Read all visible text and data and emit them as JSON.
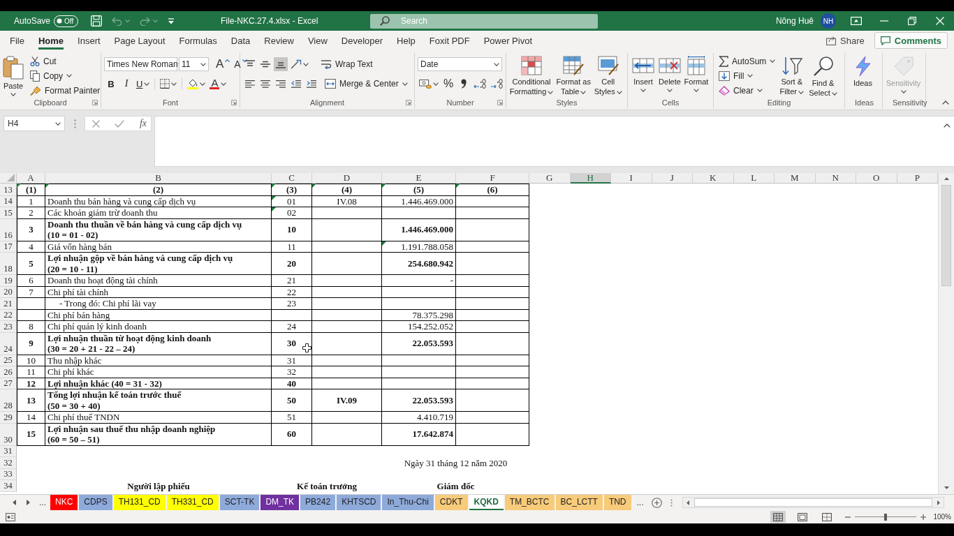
{
  "title_bar": {
    "autosave_label": "AutoSave",
    "autosave_on": false,
    "autosave_state": "Off",
    "undo_disabled": true,
    "redo_disabled": true,
    "document_title": "File-NKC.27.4.xlsx - Excel",
    "search_placeholder": "Search",
    "user_name": "Nông Huê",
    "user_initials": "NH"
  },
  "ribbon_tabs": [
    {
      "label": "File",
      "selected": false
    },
    {
      "label": "Home",
      "selected": true
    },
    {
      "label": "Insert",
      "selected": false
    },
    {
      "label": "Page Layout",
      "selected": false
    },
    {
      "label": "Formulas",
      "selected": false
    },
    {
      "label": "Data",
      "selected": false
    },
    {
      "label": "Review",
      "selected": false
    },
    {
      "label": "View",
      "selected": false
    },
    {
      "label": "Developer",
      "selected": false
    },
    {
      "label": "Help",
      "selected": false
    },
    {
      "label": "Foxit PDF",
      "selected": false
    },
    {
      "label": "Power Pivot",
      "selected": false
    }
  ],
  "ribbon_actions": {
    "share": "Share",
    "comments": "Comments"
  },
  "ribbon": {
    "clipboard": {
      "name": "Clipboard",
      "paste": "Paste",
      "cut": "Cut",
      "copy": "Copy",
      "format_painter": "Format Painter"
    },
    "font": {
      "name": "Font",
      "font_name": "Times New Roman",
      "font_size": "11",
      "grow": "A",
      "shrink": "A",
      "bold": "B",
      "italic": "I",
      "underline": "U",
      "font_color": "A"
    },
    "alignment": {
      "name": "Alignment",
      "vertical": [
        {
          "selected": false
        },
        {
          "selected": false
        },
        {
          "selected": true
        }
      ],
      "wrap_text": "Wrap Text",
      "merge_center": "Merge & Center"
    },
    "number": {
      "name": "Number",
      "format": "Date",
      "percent": "%"
    },
    "styles": {
      "name": "Styles",
      "buttons": [
        "Conditional Formatting",
        "Format as Table",
        "Cell Styles"
      ]
    },
    "cells": {
      "name": "Cells",
      "buttons": [
        "Insert",
        "Delete",
        "Format"
      ]
    },
    "editing": {
      "name": "Editing",
      "autosum": "AutoSum",
      "fill": "Fill",
      "clear": "Clear",
      "sort_filter": "Sort & Filter",
      "find_select": "Find & Select"
    },
    "ideas": {
      "name": "Ideas",
      "button": "Ideas",
      "disabled": false
    },
    "sensitivity": {
      "name": "Sensitivity",
      "button": "Sensitivity",
      "disabled": true
    }
  },
  "formula_bar": {
    "name_box": "H4",
    "function_label": "fx"
  },
  "sheet": {
    "columns": [
      {
        "label": "A",
        "selected": false
      },
      {
        "label": "B",
        "selected": false
      },
      {
        "label": "C",
        "selected": false
      },
      {
        "label": "D",
        "selected": false
      },
      {
        "label": "E",
        "selected": false
      },
      {
        "label": "F",
        "selected": false
      },
      {
        "label": "G",
        "selected": false
      },
      {
        "label": "H",
        "selected": true
      },
      {
        "label": "I",
        "selected": false
      },
      {
        "label": "J",
        "selected": false
      },
      {
        "label": "K",
        "selected": false
      },
      {
        "label": "L",
        "selected": false
      },
      {
        "label": "M",
        "selected": false
      },
      {
        "label": "N",
        "selected": false
      },
      {
        "label": "O",
        "selected": false
      },
      {
        "label": "P",
        "selected": false
      }
    ],
    "rows": [
      {
        "row": "13",
        "kind": "header",
        "bold": true,
        "indented": false,
        "cells": [
          {
            "text": "(1)",
            "marked": true
          },
          {
            "text": "(2)",
            "marked": true
          },
          {
            "text": "(3)",
            "marked": true
          },
          {
            "text": "(4)",
            "marked": true
          },
          {
            "text": "(5)",
            "marked": true
          },
          {
            "text": "(6)",
            "marked": true
          }
        ]
      },
      {
        "row": "14",
        "kind": "table",
        "bold": false,
        "indented": false,
        "cells": [
          {
            "text": "1",
            "marked": false
          },
          {
            "text": "Doanh thu bán hàng và cung cấp dịch vụ",
            "marked": false
          },
          {
            "text": "01",
            "marked": true
          },
          {
            "text": "IV.08",
            "marked": false
          },
          {
            "text": "1.446.469.000",
            "marked": false
          },
          {
            "marked": false
          }
        ]
      },
      {
        "row": "15",
        "kind": "table",
        "bold": false,
        "indented": false,
        "cells": [
          {
            "text": "2",
            "marked": false
          },
          {
            "text": "Các khoản giảm trừ doanh thu",
            "marked": false
          },
          {
            "text": "02",
            "marked": true
          },
          {
            "marked": false
          },
          {
            "marked": false
          },
          {
            "marked": false
          }
        ]
      },
      {
        "row": "16",
        "kind": "table",
        "bold": true,
        "indented": false,
        "cells": [
          {
            "text": "3",
            "marked": false
          },
          {
            "text": "Doanh thu thuần về bán hàng và cung cấp dịch vụ\n(10 = 01 - 02)",
            "marked": false
          },
          {
            "text": "10",
            "marked": false
          },
          {
            "marked": false
          },
          {
            "text": "1.446.469.000",
            "marked": false
          },
          {
            "marked": false
          }
        ]
      },
      {
        "row": "17",
        "kind": "table",
        "bold": false,
        "indented": false,
        "cells": [
          {
            "text": "4",
            "marked": false
          },
          {
            "text": "Giá vốn hàng bán",
            "marked": false
          },
          {
            "text": "11",
            "marked": false
          },
          {
            "marked": false
          },
          {
            "text": "1.191.788.058",
            "marked": true
          },
          {
            "marked": false
          }
        ]
      },
      {
        "row": "18",
        "kind": "table",
        "bold": true,
        "indented": false,
        "cells": [
          {
            "text": "5",
            "marked": false
          },
          {
            "text": "Lợi nhuận gộp về bán hàng và cung cấp dịch vụ\n(20 = 10 - 11)",
            "marked": false
          },
          {
            "text": "20",
            "marked": false
          },
          {
            "marked": false
          },
          {
            "text": "254.680.942",
            "marked": false
          },
          {
            "marked": false
          }
        ]
      },
      {
        "row": "19",
        "kind": "table",
        "bold": false,
        "indented": false,
        "cells": [
          {
            "text": "6",
            "marked": false
          },
          {
            "text": "Doanh thu hoạt động tài chính",
            "marked": false
          },
          {
            "text": "21",
            "marked": false
          },
          {
            "marked": false
          },
          {
            "text": "-",
            "marked": false
          },
          {
            "marked": false
          }
        ]
      },
      {
        "row": "20",
        "kind": "table",
        "bold": false,
        "indented": false,
        "cells": [
          {
            "text": "7",
            "marked": false
          },
          {
            "text": "Chi phí tài chính",
            "marked": false
          },
          {
            "text": "22",
            "marked": false
          },
          {
            "marked": false
          },
          {
            "marked": false
          },
          {
            "marked": false
          }
        ]
      },
      {
        "row": "21",
        "kind": "table",
        "bold": false,
        "indented": true,
        "cells": [
          {
            "marked": false
          },
          {
            "text": "- Trong đó: Chi phí lãi vay",
            "marked": false
          },
          {
            "text": "23",
            "marked": false
          },
          {
            "marked": false
          },
          {
            "marked": false
          },
          {
            "marked": false
          }
        ]
      },
      {
        "row": "22",
        "kind": "table",
        "bold": false,
        "indented": false,
        "cells": [
          {
            "marked": false
          },
          {
            "text": "Chi phí bán hàng",
            "marked": false
          },
          {
            "marked": false
          },
          {
            "marked": false
          },
          {
            "text": "78.375.298",
            "marked": false
          },
          {
            "marked": false
          }
        ]
      },
      {
        "row": "23",
        "kind": "table",
        "bold": false,
        "indented": false,
        "cells": [
          {
            "text": "8",
            "marked": false
          },
          {
            "text": "Chi phí quản lý kinh doanh",
            "marked": false
          },
          {
            "text": "24",
            "marked": false
          },
          {
            "marked": false
          },
          {
            "text": "154.252.052",
            "marked": false
          },
          {
            "marked": false
          }
        ]
      },
      {
        "row": "24",
        "kind": "table",
        "bold": true,
        "indented": false,
        "cells": [
          {
            "text": "9",
            "marked": false
          },
          {
            "text": "Lợi nhuận thuần từ hoạt động kinh doanh\n(30 = 20 + 21 - 22 – 24)",
            "marked": false
          },
          {
            "text": "30",
            "marked": false
          },
          {
            "marked": false
          },
          {
            "text": "22.053.593",
            "marked": false
          },
          {
            "marked": false
          }
        ]
      },
      {
        "row": "25",
        "kind": "table",
        "bold": false,
        "indented": false,
        "cells": [
          {
            "text": "10",
            "marked": false
          },
          {
            "text": "Thu nhập khác",
            "marked": false
          },
          {
            "text": "31",
            "marked": false
          },
          {
            "marked": false
          },
          {
            "marked": false
          },
          {
            "marked": false
          }
        ]
      },
      {
        "row": "26",
        "kind": "table",
        "bold": false,
        "indented": false,
        "cells": [
          {
            "text": "11",
            "marked": false
          },
          {
            "text": "Chi phí khác",
            "marked": false
          },
          {
            "text": "32",
            "marked": false
          },
          {
            "marked": false
          },
          {
            "marked": false
          },
          {
            "marked": false
          }
        ]
      },
      {
        "row": "27",
        "kind": "table",
        "bold": true,
        "indented": false,
        "cells": [
          {
            "text": "12",
            "marked": false
          },
          {
            "text": "Lợi nhuận khác (40 = 31 - 32)",
            "marked": false
          },
          {
            "text": "40",
            "marked": false
          },
          {
            "marked": false
          },
          {
            "marked": false
          },
          {
            "marked": false
          }
        ]
      },
      {
        "row": "28",
        "kind": "table",
        "bold": true,
        "indented": false,
        "cells": [
          {
            "text": "13",
            "marked": false
          },
          {
            "text": "Tổng lợi nhuận kế toán trước thuế\n(50 = 30 + 40)",
            "marked": false
          },
          {
            "text": "50",
            "marked": false
          },
          {
            "text": "IV.09",
            "marked": false
          },
          {
            "text": "22.053.593",
            "marked": false
          },
          {
            "marked": false
          }
        ]
      },
      {
        "row": "29",
        "kind": "table",
        "bold": false,
        "indented": false,
        "cells": [
          {
            "text": "14",
            "marked": false
          },
          {
            "text": "Chi phí thuế TNDN",
            "marked": false
          },
          {
            "text": "51",
            "marked": false
          },
          {
            "marked": false
          },
          {
            "text": "4.410.719",
            "marked": false
          },
          {
            "marked": false
          }
        ]
      },
      {
        "row": "30",
        "kind": "table",
        "bold": true,
        "indented": false,
        "cells": [
          {
            "text": "15",
            "marked": false
          },
          {
            "text": "Lợi nhuận sau thuế thu nhập doanh nghiệp\n(60 = 50 – 51)",
            "marked": false
          },
          {
            "text": "60",
            "marked": false
          },
          {
            "marked": false
          },
          {
            "text": "17.642.874",
            "marked": false
          },
          {
            "marked": false
          }
        ]
      },
      {
        "row": "31",
        "kind": "note"
      },
      {
        "row": "32",
        "kind": "note",
        "bold": false,
        "e_f": "Ngày 31 tháng 12 năm 2020"
      },
      {
        "row": "33",
        "kind": "note"
      },
      {
        "row": "34",
        "kind": "note",
        "bold": true,
        "b": "Người lập phiếu",
        "c_d": "Kế toán trưởng",
        "e_f": "Giám đốc"
      }
    ]
  },
  "sheet_tab_bar": {
    "more_left": "...",
    "tabs": [
      {
        "label": "NKC",
        "color": "#ff0000",
        "selected": false
      },
      {
        "label": "CDPS",
        "color": "#8eaadb",
        "selected": false
      },
      {
        "label": "TH131_CD",
        "color": "#ffff00",
        "selected": false
      },
      {
        "label": "TH331_CD",
        "color": "#ffff00",
        "selected": false
      },
      {
        "label": "SCT-TK",
        "color": "#8eaadb",
        "selected": false
      },
      {
        "label": "DM_TK",
        "color": "#7030a0",
        "selected": false
      },
      {
        "label": "PB242",
        "color": "#8eaadb",
        "selected": false
      },
      {
        "label": "KHTSCD",
        "color": "#8eaadb",
        "selected": false
      },
      {
        "label": "In_Thu-Chi",
        "color": "#8eaadb",
        "selected": false
      },
      {
        "label": "CDKT",
        "color": "#f8cb7a",
        "selected": false
      },
      {
        "label": "KQKD",
        "selected": true
      },
      {
        "label": "TM_BCTC",
        "color": "#f8cb7a",
        "selected": false
      },
      {
        "label": "BC_LCTT",
        "color": "#f8cb7a",
        "selected": false
      },
      {
        "label": "TND",
        "color": "#f8cb7a",
        "selected": false
      }
    ],
    "more_right": "..."
  },
  "status_bar": {
    "views": [
      {
        "selected": true
      },
      {
        "selected": false
      },
      {
        "selected": false
      }
    ],
    "zoom_slider": {
      "level": 0.5
    },
    "zoom": "100%"
  }
}
